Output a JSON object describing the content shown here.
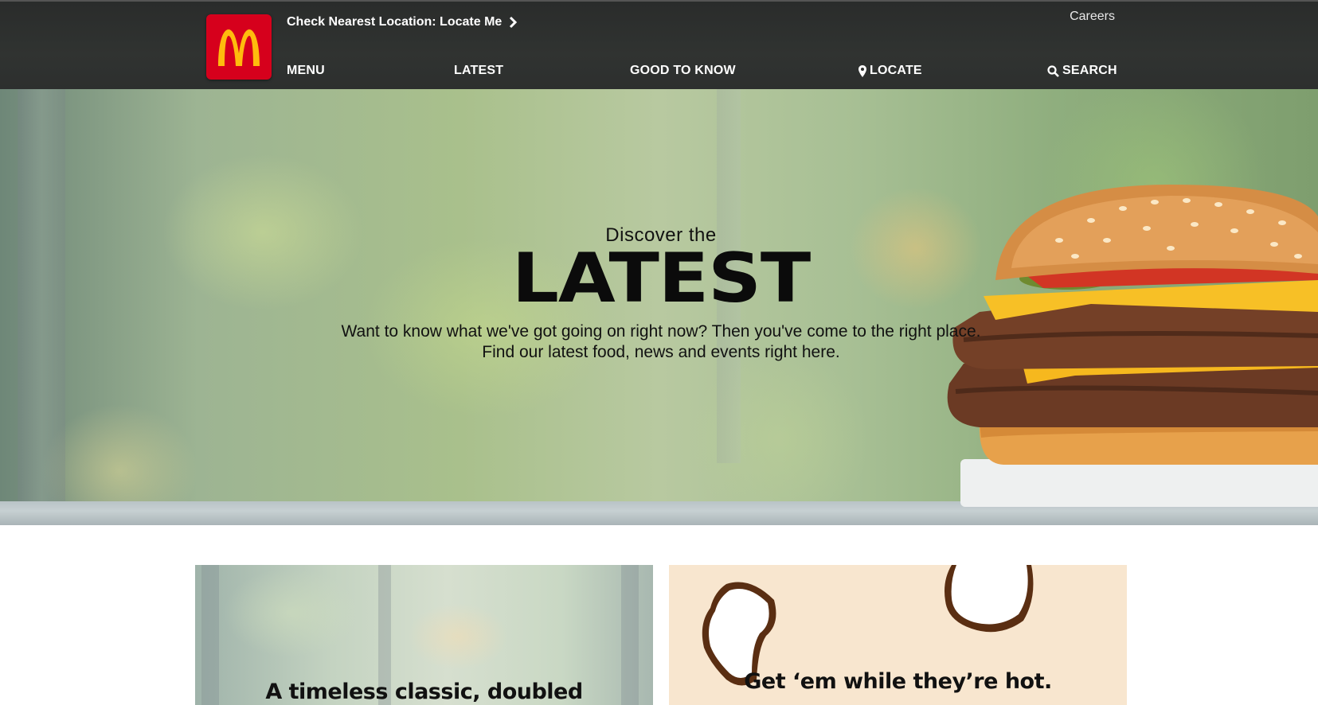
{
  "brand": {
    "logo_alt": "McDonald's",
    "logo_color": "#d6001c",
    "arches_color": "#ffbc0d"
  },
  "header": {
    "locate_prompt": "Check Nearest Location: Locate Me",
    "careers_label": "Careers",
    "nav": {
      "menu": "MENU",
      "latest": "LATEST",
      "good_to_know": "GOOD TO KNOW",
      "locate": "LOCATE",
      "search": "SEARCH"
    }
  },
  "hero": {
    "kicker": "Discover the",
    "title": "LATEST",
    "description": "Want to know what we've got going on right now? Then you've come to the right place. Find our latest food, news and events right here."
  },
  "cards": [
    {
      "heading": "A timeless classic, doubled"
    },
    {
      "heading": "Get ‘em while they’re hot."
    }
  ]
}
